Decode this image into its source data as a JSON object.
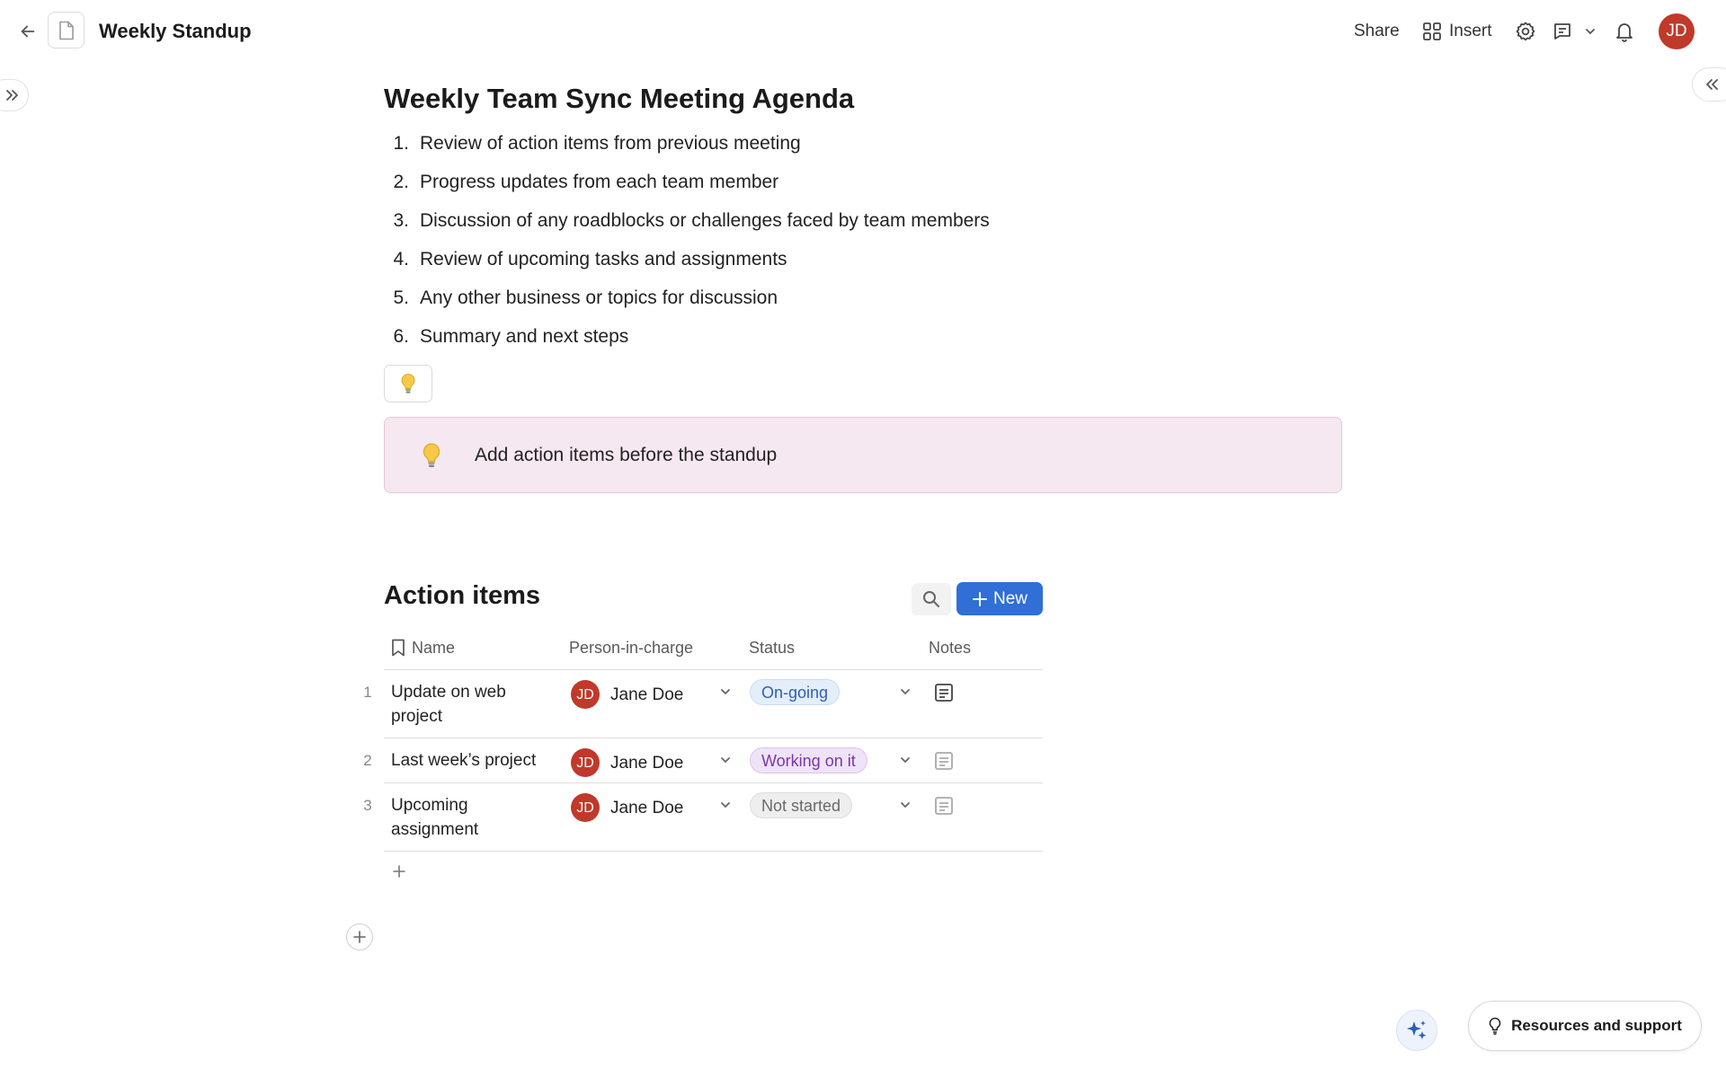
{
  "header": {
    "doc_title": "Weekly Standup",
    "share_label": "Share",
    "insert_label": "Insert",
    "user_initials": "JD"
  },
  "document": {
    "heading": "Weekly Team Sync Meeting Agenda",
    "agenda": [
      {
        "num": "1.",
        "text": "Review of action items from previous meeting"
      },
      {
        "num": "2.",
        "text": "Progress updates from each team member"
      },
      {
        "num": "3.",
        "text": "Discussion of any roadblocks or challenges faced by team members"
      },
      {
        "num": "4.",
        "text": "Review of upcoming tasks and assignments"
      },
      {
        "num": "5.",
        "text": "Any other business or topics for discussion"
      },
      {
        "num": "6.",
        "text": "Summary and next steps"
      }
    ],
    "callout_text": "Add action items before the standup"
  },
  "table": {
    "title": "Action items",
    "new_label": "New",
    "columns": [
      "Name",
      "Person-in-charge",
      "Status",
      "Notes"
    ],
    "rows": [
      {
        "num": "1",
        "name": "Update on web project",
        "person": "Jane Doe",
        "initials": "JD",
        "status": "On-going"
      },
      {
        "num": "2",
        "name": "Last week’s project",
        "person": "Jane Doe",
        "initials": "JD",
        "status": "Working on it"
      },
      {
        "num": "3",
        "name": "Upcoming assignment",
        "person": "Jane Doe",
        "initials": "JD",
        "status": "Not started"
      }
    ]
  },
  "footer": {
    "resources_label": "Resources and support"
  },
  "colors": {
    "accent": "#2f6fd6",
    "avatar": "#c0392b",
    "callout_bg": "#f6e8f0",
    "status_ongoing_bg": "#e4eefb",
    "status_ongoing_fg": "#2f5fae",
    "status_working_bg": "#efe3f8",
    "status_working_fg": "#7a37a8",
    "status_notstarted_bg": "#eeeeee",
    "status_notstarted_fg": "#6a6a6a"
  },
  "icons": [
    "back-arrow-icon",
    "document-icon",
    "insert-grid-icon",
    "gear-icon",
    "comment-icon",
    "chevron-down-icon",
    "bell-icon",
    "expand-sidebar-icon",
    "collapse-sidebar-icon",
    "lightbulb-icon",
    "search-icon",
    "plus-icon",
    "bookmark-icon",
    "note-icon",
    "sparkle-icon"
  ]
}
